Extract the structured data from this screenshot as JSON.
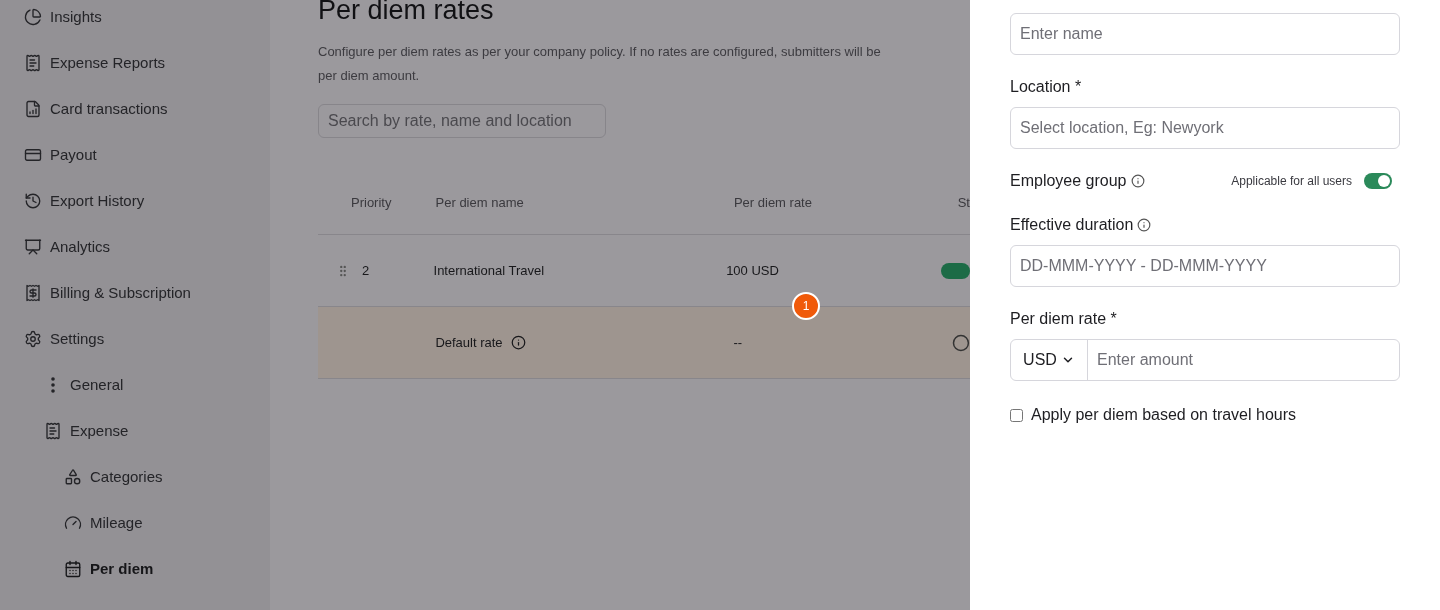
{
  "sidebar": {
    "items": [
      {
        "label": "Insights",
        "selected": false
      },
      {
        "label": "Expense Reports",
        "selected": false
      },
      {
        "label": "Card transactions",
        "selected": false
      },
      {
        "label": "Payout",
        "selected": false
      },
      {
        "label": "Export History",
        "selected": false
      },
      {
        "label": "Analytics",
        "selected": false
      },
      {
        "label": "Billing & Subscription",
        "selected": false
      },
      {
        "label": "Settings",
        "selected": false,
        "children": [
          {
            "label": "General",
            "selected": false
          },
          {
            "label": "Expense",
            "selected": false,
            "children": [
              {
                "label": "Categories",
                "selected": false
              },
              {
                "label": "Mileage",
                "selected": false
              },
              {
                "label": "Per diem",
                "selected": true
              }
            ]
          }
        ]
      }
    ]
  },
  "page": {
    "title": "Per diem rates",
    "description_lines": [
      "Configure per diem rates as per your company policy. If no rates are configured, submitters will be",
      "per diem amount."
    ],
    "search": {
      "placeholder": "Search by rate, name and location"
    },
    "table": {
      "columns": [
        "Priority",
        "Per diem name",
        "Per diem rate",
        "St"
      ],
      "rows": [
        {
          "kind": "rate",
          "priority": "2",
          "name": "International Travel",
          "rate": "100 USD",
          "highlighted": false,
          "status_on": true
        },
        {
          "kind": "default",
          "name": "Default rate",
          "rate": "--",
          "highlighted": true
        }
      ]
    },
    "badge": "1"
  },
  "drawer": {
    "name_field": {
      "placeholder": "Enter name"
    },
    "location": {
      "label": "Location *",
      "placeholder": "Select location, Eg: Newyork"
    },
    "employee_group": {
      "label": "Employee group",
      "toggle_label": "Applicable for all users",
      "on": true
    },
    "effective_duration": {
      "label": "Effective duration",
      "placeholder": "DD-MMM-YYYY - DD-MMM-YYYY"
    },
    "rate": {
      "label": "Per diem rate *",
      "currency": "USD",
      "placeholder": "Enter amount"
    },
    "travel_hours": {
      "label": "Apply per diem based on travel hours",
      "checked": false
    }
  }
}
